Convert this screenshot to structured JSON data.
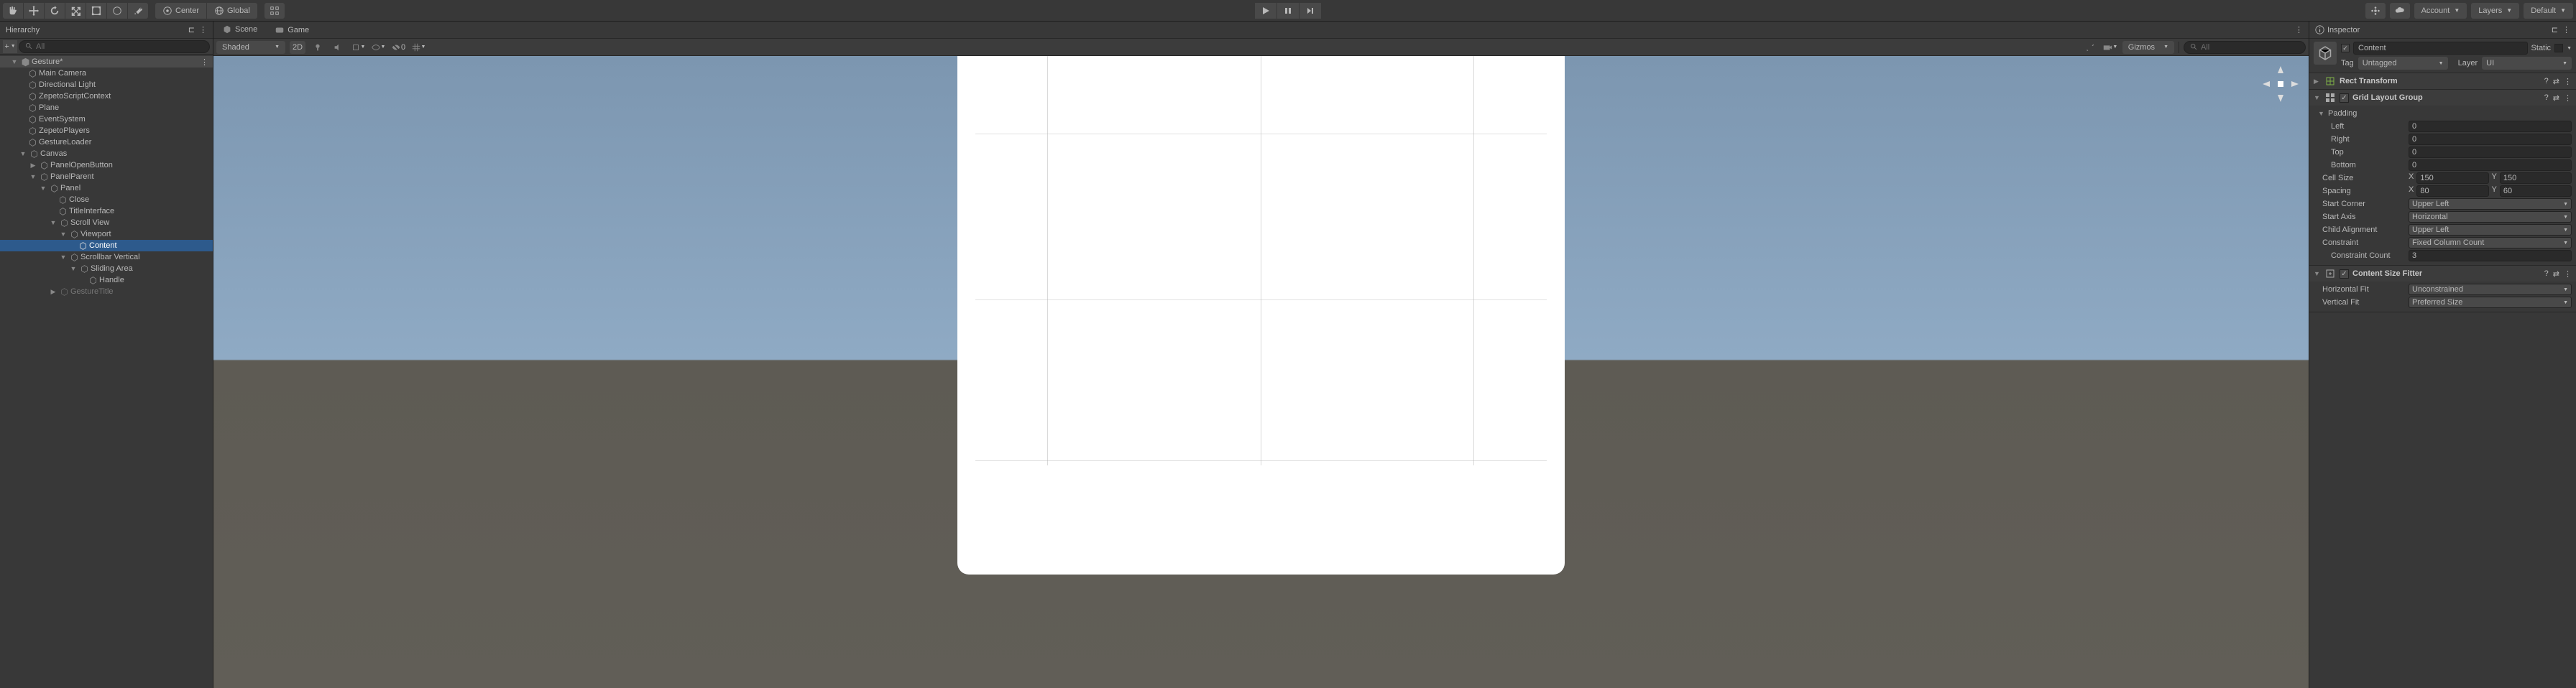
{
  "toolbar": {
    "center_label": "Center",
    "global_label": "Global",
    "account_label": "Account",
    "layers_label": "Layers",
    "layout_label": "Default"
  },
  "hierarchy": {
    "title": "Hierarchy",
    "search_placeholder": "All",
    "scene_name": "Gesture*",
    "nodes": {
      "main_camera": "Main Camera",
      "directional_light": "Directional Light",
      "zepeto_script": "ZepetoScriptContext",
      "plane": "Plane",
      "event_system": "EventSystem",
      "zepeto_players": "ZepetoPlayers",
      "gesture_loader": "GestureLoader",
      "canvas": "Canvas",
      "panel_open_button": "PanelOpenButton",
      "panel_parent": "PanelParent",
      "panel": "Panel",
      "close": "Close",
      "title_interface": "TitleInterface",
      "scroll_view": "Scroll View",
      "viewport": "Viewport",
      "content": "Content",
      "scrollbar_vertical": "Scrollbar Vertical",
      "sliding_area": "Sliding Area",
      "handle": "Handle",
      "gesture_title": "GestureTitle"
    }
  },
  "scene": {
    "scene_tab": "Scene",
    "game_tab": "Game",
    "shading_mode": "Shaded",
    "view_2d": "2D",
    "gizmos_label": "Gizmos",
    "search_placeholder": "All",
    "zero_label": "0"
  },
  "inspector": {
    "title": "Inspector",
    "go_name": "Content",
    "static_label": "Static",
    "tag_label": "Tag",
    "tag_value": "Untagged",
    "layer_label": "Layer",
    "layer_value": "UI",
    "rect_transform": {
      "title": "Rect Transform"
    },
    "grid_layout": {
      "title": "Grid Layout Group",
      "padding_label": "Padding",
      "left_label": "Left",
      "left_val": "0",
      "right_label": "Right",
      "right_val": "0",
      "top_label": "Top",
      "top_val": "0",
      "bottom_label": "Bottom",
      "bottom_val": "0",
      "cell_size_label": "Cell Size",
      "cell_x": "150",
      "cell_y": "150",
      "spacing_label": "Spacing",
      "spacing_x": "80",
      "spacing_y": "60",
      "start_corner_label": "Start Corner",
      "start_corner_val": "Upper Left",
      "start_axis_label": "Start Axis",
      "start_axis_val": "Horizontal",
      "child_align_label": "Child Alignment",
      "child_align_val": "Upper Left",
      "constraint_label": "Constraint",
      "constraint_val": "Fixed Column Count",
      "constraint_count_label": "Constraint Count",
      "constraint_count_val": "3",
      "x_label": "X",
      "y_label": "Y"
    },
    "content_fitter": {
      "title": "Content Size Fitter",
      "hfit_label": "Horizontal Fit",
      "hfit_val": "Unconstrained",
      "vfit_label": "Vertical Fit",
      "vfit_val": "Preferred Size"
    }
  }
}
